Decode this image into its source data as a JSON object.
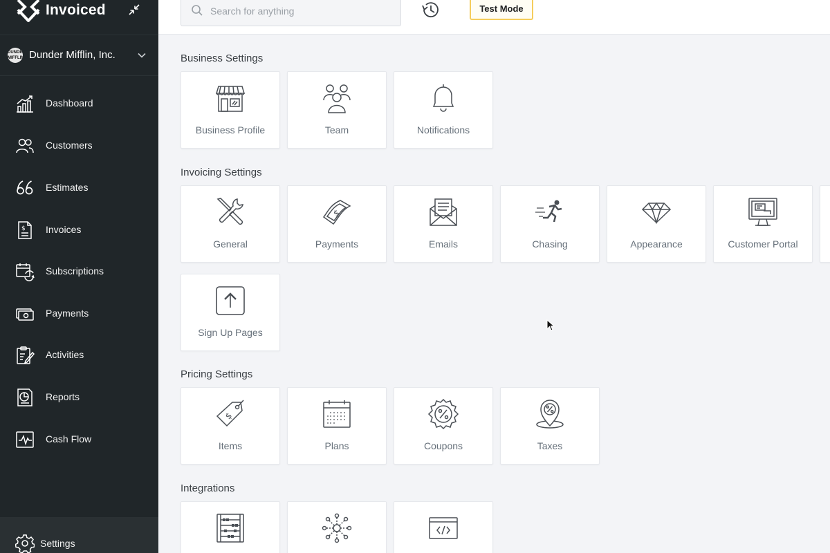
{
  "brand": {
    "name": "Invoiced"
  },
  "company": {
    "name": "Dunder Mifflin, Inc.",
    "avatar_text": "DUNDER MIFFLIN"
  },
  "nav": {
    "items": [
      {
        "label": "Dashboard",
        "icon": "dashboard-icon"
      },
      {
        "label": "Customers",
        "icon": "customers-icon"
      },
      {
        "label": "Estimates",
        "icon": "estimates-icon"
      },
      {
        "label": "Invoices",
        "icon": "invoices-icon"
      },
      {
        "label": "Subscriptions",
        "icon": "subscriptions-icon"
      },
      {
        "label": "Payments",
        "icon": "payments-icon"
      },
      {
        "label": "Activities",
        "icon": "activities-icon"
      },
      {
        "label": "Reports",
        "icon": "reports-icon"
      },
      {
        "label": "Cash Flow",
        "icon": "cash-flow-icon"
      }
    ],
    "settings_label": "Settings"
  },
  "topbar": {
    "search_placeholder": "Search for anything",
    "test_mode_label": "Test Mode"
  },
  "sections": {
    "business": {
      "title": "Business Settings",
      "cards": [
        {
          "label": "Business Profile",
          "icon": "storefront-icon"
        },
        {
          "label": "Team",
          "icon": "team-icon"
        },
        {
          "label": "Notifications",
          "icon": "bell-icon"
        }
      ]
    },
    "invoicing": {
      "title": "Invoicing Settings",
      "cards": [
        {
          "label": "General",
          "icon": "tools-icon"
        },
        {
          "label": "Payments",
          "icon": "money-icon"
        },
        {
          "label": "Emails",
          "icon": "envelope-icon"
        },
        {
          "label": "Chasing",
          "icon": "runner-icon"
        },
        {
          "label": "Appearance",
          "icon": "diamond-icon"
        },
        {
          "label": "Customer Portal",
          "icon": "monitor-icon"
        },
        {
          "label": "Sign Up Pages",
          "icon": "upload-icon"
        }
      ]
    },
    "pricing": {
      "title": "Pricing Settings",
      "cards": [
        {
          "label": "Items",
          "icon": "price-tag-icon"
        },
        {
          "label": "Plans",
          "icon": "calendar-icon"
        },
        {
          "label": "Coupons",
          "icon": "coupon-badge-icon"
        },
        {
          "label": "Taxes",
          "icon": "tax-pin-icon"
        }
      ]
    },
    "integrations": {
      "title": "Integrations",
      "cards": [
        {
          "icon": "abacus-icon"
        },
        {
          "icon": "network-icon"
        },
        {
          "icon": "code-window-icon"
        }
      ]
    }
  },
  "colors": {
    "sidebar_bg": "#202629",
    "page_bg": "#f3f4f7",
    "test_mode_border": "#f5cd5c"
  }
}
